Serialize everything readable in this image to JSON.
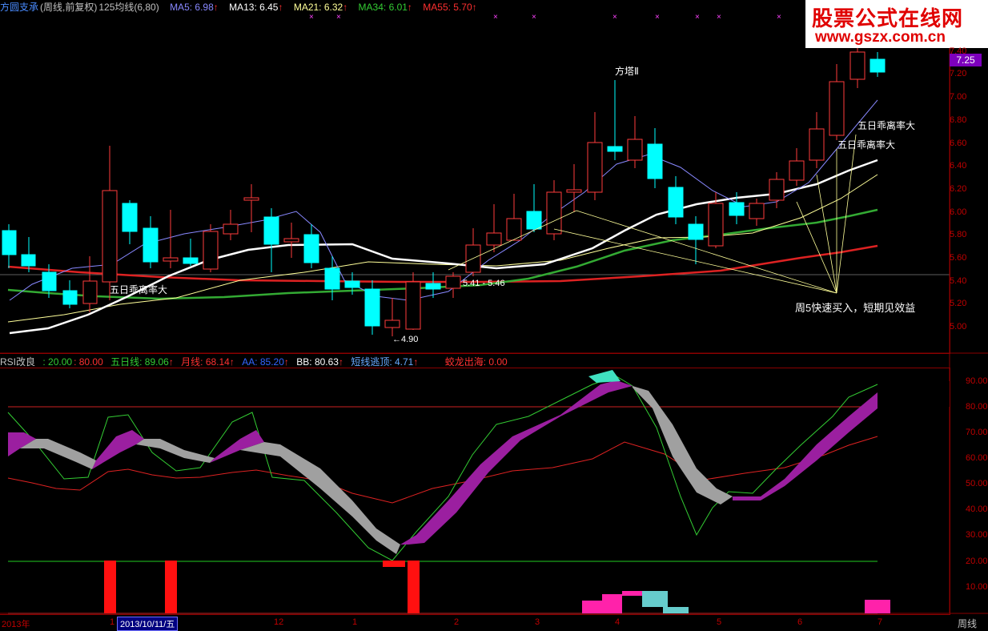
{
  "header": {
    "stock_name": "方圆支承",
    "mode": "(周线,前复权)",
    "avg": "125均线(6,80)",
    "ma5": "MA5: 6.98",
    "ma13": "MA13: 6.45",
    "ma21": "MA21: 6.32",
    "ma34": "MA34: 6.01",
    "ma55": "MA55: 5.70",
    "arrow": "↑"
  },
  "watermark": {
    "line1": "股票公式在线网",
    "line2": "www.gszx.com.cn"
  },
  "price_tag": "7.25",
  "y_axis_price": [
    "7.40",
    "7.20",
    "7.00",
    "6.80",
    "6.60",
    "6.40",
    "6.20",
    "6.00",
    "5.80",
    "5.60",
    "5.40",
    "5.20",
    "5.00"
  ],
  "y_axis_indicator": [
    "90.00",
    "80.00",
    "70.00",
    "60.00",
    "50.00",
    "40.00",
    "30.00",
    "20.00",
    "10.00"
  ],
  "annotations": {
    "fangta": "方塔Ⅱ",
    "wuri1": "五日乖离率大",
    "wuri2": "五日乖离率大",
    "wuri3": "五日乖离率大",
    "range": "5.41 - 5.46",
    "low": "←4.90",
    "buy": "周5快速买入，短期见效益"
  },
  "indicator": {
    "name": "RSI改良",
    "v1": ": 20.00",
    "v2": ": 80.00",
    "wuri": "五日线: 89.06",
    "yue": "月线: 68.14",
    "aa": "AA: 85.20",
    "bb": "BB: 80.63",
    "duanxian": "短线逃顶: 4.71",
    "jiaolong": "蛟龙出海: 0.00",
    "arrow": "↑"
  },
  "x_axis": {
    "labels": [
      "2013年",
      "1",
      "12",
      "1",
      "2",
      "3",
      "4",
      "5",
      "6",
      "7"
    ],
    "date": "2013/10/11/五",
    "period": "周线"
  },
  "colors": {
    "up": "#ff3b3b",
    "down": "#00ffff",
    "ma5": "#ffffff",
    "ma_yellow": "#ffff99",
    "ma_green": "#33aa33",
    "ma_red": "#dd2222"
  }
}
